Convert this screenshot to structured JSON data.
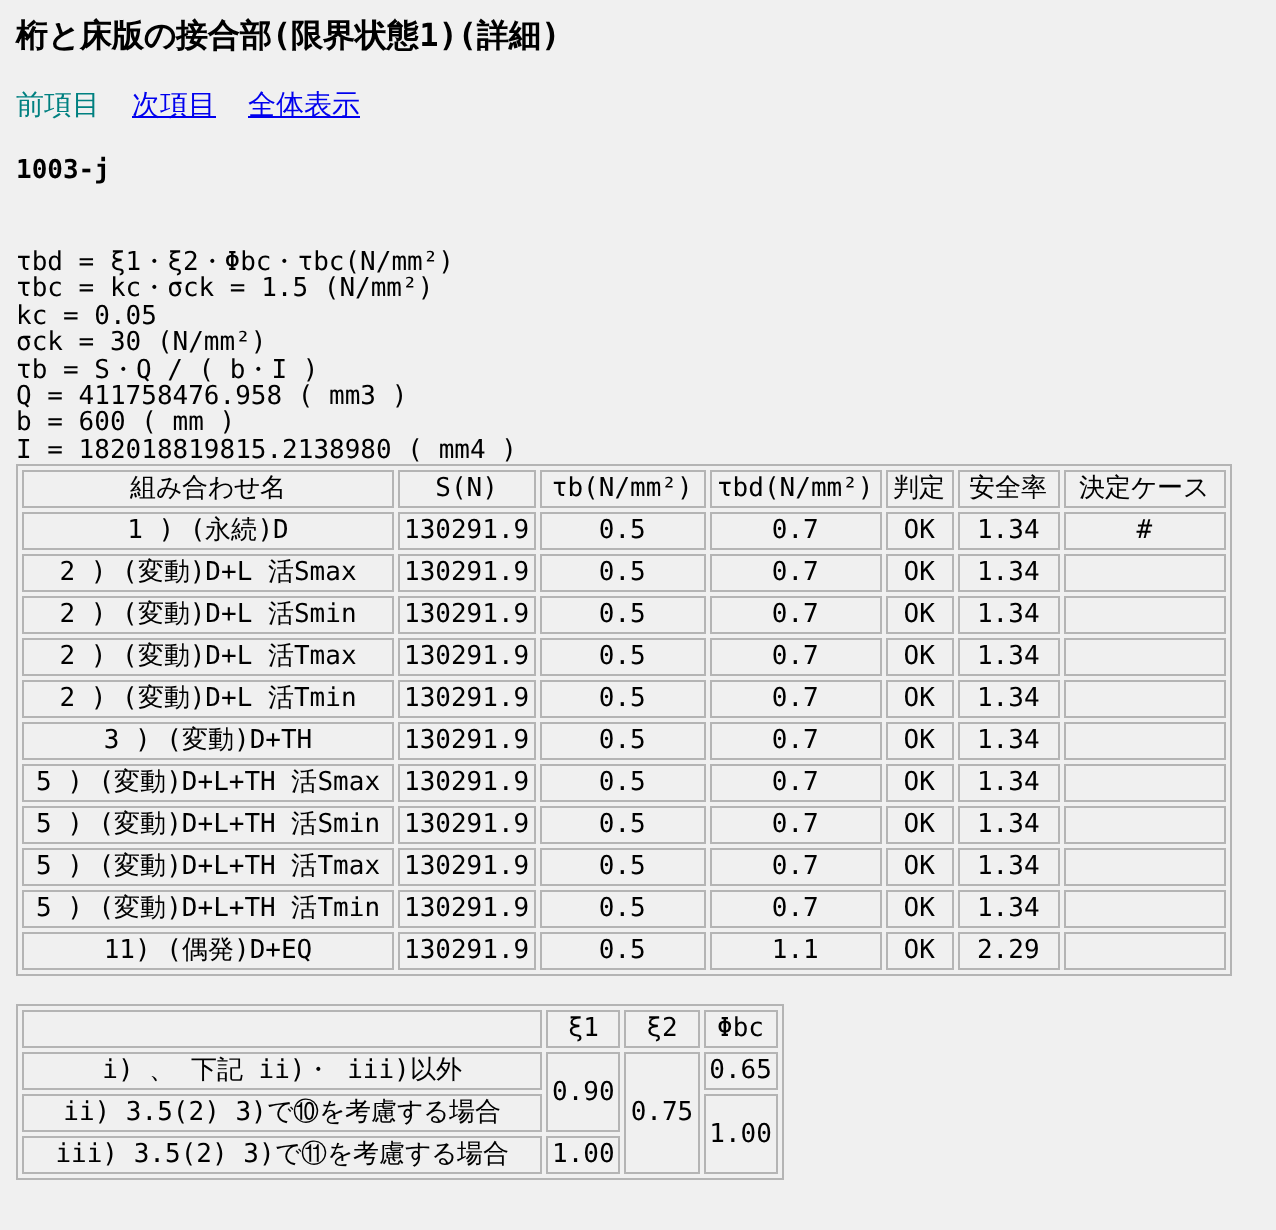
{
  "title": "桁と床版の接合部(限界状態1)(詳細)",
  "nav": [
    {
      "label": "前項目",
      "enabled": false
    },
    {
      "label": "次項目",
      "enabled": true
    },
    {
      "label": "全体表示",
      "enabled": true
    }
  ],
  "item_id": "1003-j",
  "formulas": [
    "τbd = ξ1・ξ2・Φbc・τbc(N/mm²)",
    "τbc = kc・σck = 1.5 (N/mm²)",
    "kc = 0.05",
    "σck = 30 (N/mm²)",
    "τb = S・Q / ( b・I )",
    "Q = 411758476.958 ( mm3 )",
    "b = 600 ( mm )",
    "I = 182018819815.2138980 ( mm4 )"
  ],
  "results_table": {
    "columns": [
      "組み合わせ名",
      "S(N)",
      "τb(N/mm²)",
      "τbd(N/mm²)",
      "判定",
      "安全率",
      "決定ケース"
    ],
    "rows": [
      {
        "name": "1 ) (永続)D",
        "s": "130291.9",
        "tau_b": "0.5",
        "tau_bd": "0.7",
        "judgement": "OK",
        "safety_factor": "1.34",
        "governing_case": "#"
      },
      {
        "name": "2 ) (変動)D+L 活Smax",
        "s": "130291.9",
        "tau_b": "0.5",
        "tau_bd": "0.7",
        "judgement": "OK",
        "safety_factor": "1.34"
      },
      {
        "name": "2 ) (変動)D+L 活Smin",
        "s": "130291.9",
        "tau_b": "0.5",
        "tau_bd": "0.7",
        "judgement": "OK",
        "safety_factor": "1.34"
      },
      {
        "name": "2 ) (変動)D+L 活Tmax",
        "s": "130291.9",
        "tau_b": "0.5",
        "tau_bd": "0.7",
        "judgement": "OK",
        "safety_factor": "1.34"
      },
      {
        "name": "2 ) (変動)D+L 活Tmin",
        "s": "130291.9",
        "tau_b": "0.5",
        "tau_bd": "0.7",
        "judgement": "OK",
        "safety_factor": "1.34"
      },
      {
        "name": "3 ) (変動)D+TH",
        "s": "130291.9",
        "tau_b": "0.5",
        "tau_bd": "0.7",
        "judgement": "OK",
        "safety_factor": "1.34"
      },
      {
        "name": "5 ) (変動)D+L+TH 活Smax",
        "s": "130291.9",
        "tau_b": "0.5",
        "tau_bd": "0.7",
        "judgement": "OK",
        "safety_factor": "1.34"
      },
      {
        "name": "5 ) (変動)D+L+TH 活Smin",
        "s": "130291.9",
        "tau_b": "0.5",
        "tau_bd": "0.7",
        "judgement": "OK",
        "safety_factor": "1.34"
      },
      {
        "name": "5 ) (変動)D+L+TH 活Tmax",
        "s": "130291.9",
        "tau_b": "0.5",
        "tau_bd": "0.7",
        "judgement": "OK",
        "safety_factor": "1.34"
      },
      {
        "name": "5 ) (変動)D+L+TH 活Tmin",
        "s": "130291.9",
        "tau_b": "0.5",
        "tau_bd": "0.7",
        "judgement": "OK",
        "safety_factor": "1.34"
      },
      {
        "name": "11) (偶発)D+EQ",
        "s": "130291.9",
        "tau_b": "0.5",
        "tau_bd": "1.1",
        "judgement": "OK",
        "safety_factor": "2.29"
      }
    ]
  },
  "coefficient_table": {
    "columns": [
      "ξ1",
      "ξ2",
      "Φbc"
    ],
    "rows": [
      "i) 、 下記 ii)・ iii)以外",
      "ii) 3.5(2) 3)で⑩を考慮する場合",
      "iii) 3.5(2) 3)で⑪を考慮する場合"
    ],
    "xi1": [
      "0.90",
      "1.00"
    ],
    "xi2": "0.75",
    "phi_bc": [
      "0.65",
      "1.00"
    ]
  }
}
